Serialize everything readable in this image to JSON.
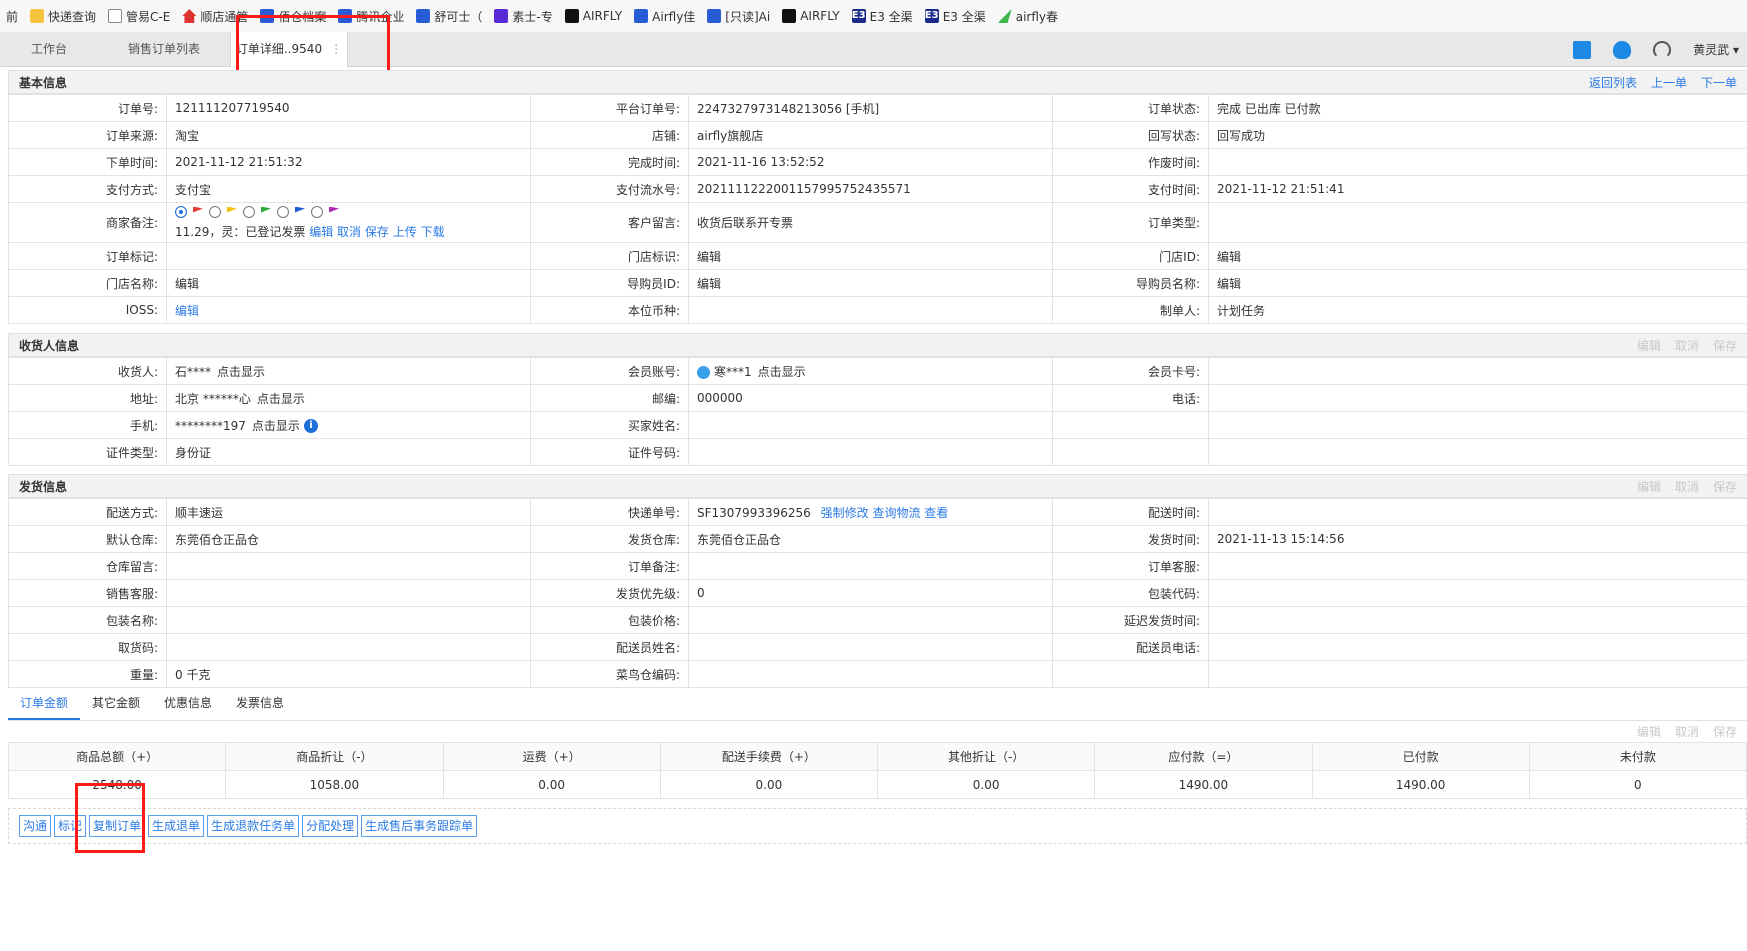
{
  "bookmarks": [
    {
      "label": "前",
      "icon": ""
    },
    {
      "label": "快递查询",
      "icon": "folder-icon"
    },
    {
      "label": "管易C-E",
      "icon": "document-icon"
    },
    {
      "label": "顺店通管",
      "icon": "house-icon"
    },
    {
      "label": "佰仓档案",
      "icon": "bookmark-icon"
    },
    {
      "label": "腾讯企业",
      "icon": "bookmark-icon"
    },
    {
      "label": "舒可士（",
      "icon": "bookmark-icon"
    },
    {
      "label": "素士-专",
      "icon": "purple-logo-icon"
    },
    {
      "label": "AIRFLY",
      "icon": "airfly-logo-icon"
    },
    {
      "label": "Airfly佳",
      "icon": "blue-logo-icon"
    },
    {
      "label": "[只读]Ai",
      "icon": "blue-logo-icon"
    },
    {
      "label": "AIRFLY",
      "icon": "airfly-logo-icon"
    },
    {
      "label": "E3 全渠",
      "icon": "e3-logo-icon"
    },
    {
      "label": "E3 全渠",
      "icon": "e3-logo-icon"
    },
    {
      "label": "airfly春",
      "icon": "leaf-icon"
    }
  ],
  "tabs": {
    "workbench": "工作台",
    "sales_list": "销售订单列表",
    "order_detail": "订单详细..9540",
    "more": "⋮"
  },
  "toolbar": {
    "user": "黄灵武 ▾"
  },
  "basic": {
    "title": "基本信息",
    "back": "返回列表",
    "prev": "上一单",
    "next": "下一单",
    "rows": [
      [
        {
          "l": "订单号:",
          "v": "121111207719540"
        },
        {
          "l": "平台订单号:",
          "v": "2247327973148213056 [手机]"
        },
        {
          "l": "订单状态:",
          "v": "完成 已出库 已付款"
        }
      ],
      [
        {
          "l": "订单来源:",
          "v": "淘宝"
        },
        {
          "l": "店铺:",
          "v": "airfly旗舰店"
        },
        {
          "l": "回写状态:",
          "v": "回写成功"
        }
      ],
      [
        {
          "l": "下单时间:",
          "v": "2021-11-12 21:51:32"
        },
        {
          "l": "完成时间:",
          "v": "2021-11-16 13:52:52"
        },
        {
          "l": "作废时间:",
          "v": ""
        }
      ],
      [
        {
          "l": "支付方式:",
          "v": "支付宝"
        },
        {
          "l": "支付流水号:",
          "v": "2021111222001157995752435571"
        },
        {
          "l": "支付时间:",
          "v": "2021-11-12 21:51:41"
        }
      ]
    ],
    "merchant_note_label": "商家备注:",
    "merchant_note_text": "11.29，灵：已登记发票",
    "note_actions": [
      "编辑",
      "取消",
      "保存",
      "上传",
      "下载"
    ],
    "customer_msg_label": "客户留言:",
    "customer_msg": "收货后联系开专票",
    "order_type_label": "订单类型:",
    "order_type": "",
    "rows2": [
      [
        {
          "l": "订单标记:",
          "v": "",
          "muted": false
        },
        {
          "l": "门店标识:",
          "v": "编辑",
          "muted": true
        },
        {
          "l": "门店ID:",
          "v": "编辑",
          "muted": true
        }
      ],
      [
        {
          "l": "门店名称:",
          "v": "编辑",
          "muted": true
        },
        {
          "l": "导购员ID:",
          "v": "编辑",
          "muted": true
        },
        {
          "l": "导购员名称:",
          "v": "编辑",
          "muted": true
        }
      ]
    ],
    "ioss_label": "IOSS:",
    "ioss_value": "编辑",
    "currency_label": "本位币种:",
    "currency": "",
    "maker_label": "制单人:",
    "maker": "计划任务"
  },
  "receiver": {
    "title": "收货人信息",
    "actions": [
      "编辑",
      "取消",
      "保存"
    ],
    "name_label": "收货人:",
    "name": "石****",
    "show": "点击显示",
    "member_label": "会员账号:",
    "member": "寒***1",
    "card_label": "会员卡号:",
    "addr_label": "地址:",
    "addr": "北京 ******心",
    "zip_label": "邮编:",
    "zip": "000000",
    "phone_label": "电话:",
    "mobile_label": "手机:",
    "mobile": "********197",
    "buyer_label": "买家姓名:",
    "idtype_label": "证件类型:",
    "idtype": "身份证",
    "idno_label": "证件号码:"
  },
  "shipping": {
    "title": "发货信息",
    "actions": [
      "编辑",
      "取消",
      "保存"
    ],
    "method_label": "配送方式:",
    "method": "顺丰速运",
    "tracking_label": "快递单号:",
    "tracking": "SF1307993396256",
    "tracking_links": [
      "强制修改",
      "查询物流",
      "查看"
    ],
    "ship_time_label": "配送时间:",
    "rows": [
      [
        {
          "l": "默认仓库:",
          "v": "东莞佰仓正品仓"
        },
        {
          "l": "发货仓库:",
          "v": "东莞佰仓正品仓"
        },
        {
          "l": "发货时间:",
          "v": "2021-11-13 15:14:56"
        }
      ],
      [
        {
          "l": "仓库留言:",
          "v": ""
        },
        {
          "l": "订单备注:",
          "v": ""
        },
        {
          "l": "订单客服:",
          "v": ""
        }
      ],
      [
        {
          "l": "销售客服:",
          "v": ""
        },
        {
          "l": "发货优先级:",
          "v": "0"
        },
        {
          "l": "包装代码:",
          "v": ""
        }
      ],
      [
        {
          "l": "包装名称:",
          "v": ""
        },
        {
          "l": "包装价格:",
          "v": ""
        },
        {
          "l": "延迟发货时间:",
          "v": ""
        }
      ],
      [
        {
          "l": "取货码:",
          "v": ""
        },
        {
          "l": "配送员姓名:",
          "v": ""
        },
        {
          "l": "配送员电话:",
          "v": ""
        }
      ],
      [
        {
          "l": "重量:",
          "v": "0 千克"
        },
        {
          "l": "菜鸟仓编码:",
          "v": ""
        },
        {
          "l": "",
          "v": ""
        }
      ]
    ]
  },
  "amount": {
    "tabs": [
      "订单金额",
      "其它金额",
      "优惠信息",
      "发票信息"
    ],
    "actions": [
      "编辑",
      "取消",
      "保存"
    ],
    "headers": [
      "商品总额（+）",
      "商品折让（-）",
      "运费（+）",
      "配送手续费（+）",
      "其他折让（-）",
      "应付款（=）",
      "已付款",
      "未付款"
    ],
    "values": [
      "2548.00",
      "1058.00",
      "0.00",
      "0.00",
      "0.00",
      "1490.00",
      "1490.00",
      "0"
    ]
  },
  "actions": [
    "沟通",
    "标记",
    "复制订单",
    "生成退单",
    "生成退款任务单",
    "分配处理",
    "生成售后事务跟踪单"
  ]
}
